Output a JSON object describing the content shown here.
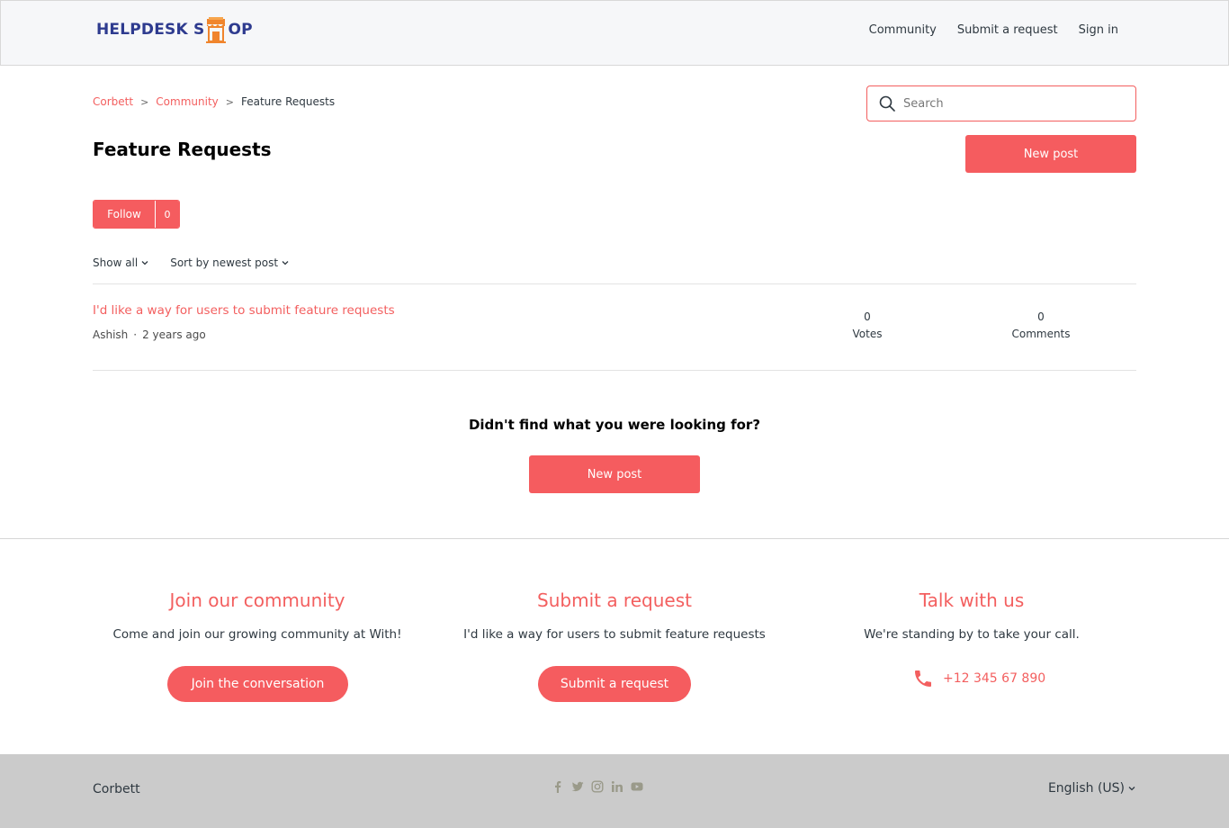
{
  "header": {
    "logo": {
      "part1": "HELPDESK S",
      "part2": "OP"
    },
    "nav": [
      {
        "label": "Community"
      },
      {
        "label": "Submit a request"
      },
      {
        "label": "Sign in"
      }
    ]
  },
  "breadcrumb": {
    "items": [
      {
        "label": "Corbett"
      },
      {
        "label": "Community"
      },
      {
        "label": "Feature Requests"
      }
    ],
    "separator": ">"
  },
  "search": {
    "placeholder": "Search"
  },
  "page": {
    "title": "Feature Requests",
    "new_post_label": "New post",
    "follow_label": "Follow",
    "follow_count": "0"
  },
  "filters": {
    "show_all": "Show all",
    "sort": "Sort by newest post"
  },
  "posts": [
    {
      "title": "I'd like a way for users to submit feature requests",
      "author": "Ashish",
      "dot": "·",
      "time": "2 years ago",
      "votes": "0",
      "votes_label": "Votes",
      "comments": "0",
      "comments_label": "Comments"
    }
  ],
  "not_found": {
    "text": "Didn't find what you were looking for?",
    "button": "New post"
  },
  "footer_columns": [
    {
      "title": "Join our community",
      "text": "Come and join our growing community at With!",
      "button": "Join the conversation"
    },
    {
      "title": "Submit a request",
      "text": "I'd like a way for users to submit feature requests",
      "button": "Submit a request"
    },
    {
      "title": "Talk with us",
      "text": "We're standing by to take your call.",
      "phone": "+12 345 67 890"
    }
  ],
  "bottom_bar": {
    "brand": "Corbett",
    "language": "English (US)",
    "socials": [
      "facebook-icon",
      "twitter-icon",
      "instagram-icon",
      "linkedin-icon",
      "youtube-icon"
    ]
  },
  "colors": {
    "accent": "#f55c5f",
    "link": "#f35f5f",
    "logo_blue": "#2e3b8f",
    "logo_orange": "#f0852d",
    "footer_bg": "#cbcbcb",
    "social_icon": "#9a9a8a"
  }
}
